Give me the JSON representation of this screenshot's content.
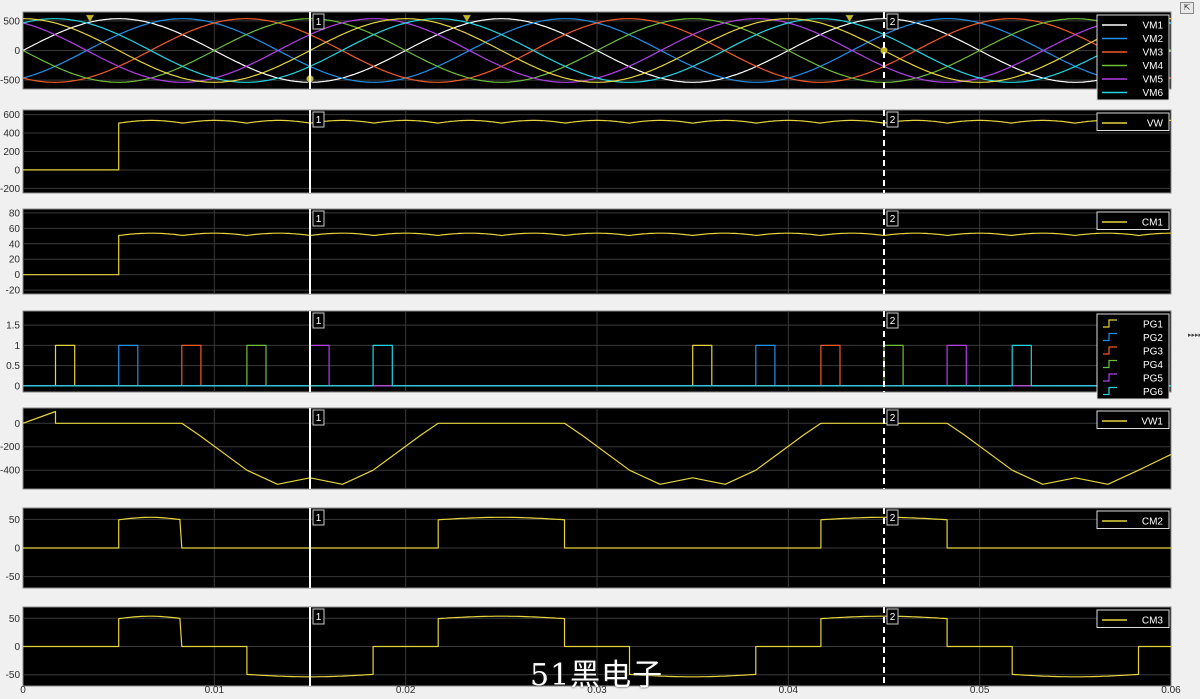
{
  "toolbar": {
    "undock_icon": "undock-icon",
    "side_arrows": "▸▸▸▸▸▸"
  },
  "watermark": "51黑电子",
  "colors": {
    "background": "#000000",
    "grid": "#3a3a3a",
    "axis_text": "#2b2b2b",
    "cursor": "#ffffff",
    "series": [
      "#ffffff",
      "#1f8fe8",
      "#f05a28",
      "#6fbf3a",
      "#b040e8",
      "#22d4e0",
      "#e6d43c"
    ],
    "marker": "#c8b820"
  },
  "cursors": [
    {
      "label": "1",
      "x": 0.015,
      "style": "solid"
    },
    {
      "label": "2",
      "x": 0.045,
      "style": "dashed"
    }
  ],
  "chart_data": [
    {
      "type": "line",
      "id": "vm",
      "x_ticks": [
        0,
        0.01,
        0.02,
        0.03,
        0.04,
        0.05,
        0.06
      ],
      "ylim": [
        -650,
        650
      ],
      "yticks": [
        500,
        0,
        -500
      ],
      "series": [
        {
          "name": "VM1",
          "color": "#ffffff",
          "amplitude": 537,
          "phase_deg": 0
        },
        {
          "name": "VM2",
          "color": "#1f8fe8",
          "amplitude": 537,
          "phase_deg": -60
        },
        {
          "name": "VM3",
          "color": "#f05a28",
          "amplitude": 537,
          "phase_deg": -120
        },
        {
          "name": "VM4",
          "color": "#6fbf3a",
          "amplitude": 537,
          "phase_deg": 180
        },
        {
          "name": "VM5",
          "color": "#b040e8",
          "amplitude": 537,
          "phase_deg": 120
        },
        {
          "name": "VM6",
          "color": "#22d4e0",
          "amplitude": 537,
          "phase_deg": 60
        }
      ],
      "frequency_hz": 50,
      "yellow_trace": {
        "phase_deg": 90,
        "amplitude": 537
      },
      "peak_markers_x": [
        0.0035,
        0.0232,
        0.0432
      ],
      "cursor_points": [
        {
          "x": 0.015,
          "y": -480
        },
        {
          "x": 0.045,
          "y": 0
        }
      ]
    },
    {
      "type": "line",
      "id": "vw",
      "ylim": [
        -250,
        650
      ],
      "yticks": [
        600,
        400,
        200,
        0,
        -200
      ],
      "series": [
        {
          "name": "VW",
          "color": "#e6d43c",
          "step_on": 0.005,
          "max": 537,
          "min": 465,
          "ripple_period": 0.00333
        }
      ]
    },
    {
      "type": "line",
      "id": "cm1",
      "ylim": [
        -25,
        85
      ],
      "yticks": [
        80,
        60,
        40,
        20,
        0,
        -20
      ],
      "series": [
        {
          "name": "CM1",
          "color": "#e6d43c",
          "step_on": 0.005,
          "max": 53.7,
          "min": 46.5,
          "ripple_period": 0.00333
        }
      ]
    },
    {
      "type": "line",
      "id": "pg",
      "ylim": [
        -0.15,
        1.85
      ],
      "yticks": [
        1.5,
        1,
        0.5,
        0
      ],
      "pulse_width": 0.001,
      "series": [
        {
          "name": "PG1",
          "color": "#e6d43c",
          "starts": [
            0.0017,
            0.035
          ]
        },
        {
          "name": "PG2",
          "color": "#1f8fe8",
          "starts": [
            0.005,
            0.0383
          ]
        },
        {
          "name": "PG3",
          "color": "#f05a28",
          "starts": [
            0.0083,
            0.0417
          ]
        },
        {
          "name": "PG4",
          "color": "#6fbf3a",
          "starts": [
            0.0117,
            0.045
          ]
        },
        {
          "name": "PG5",
          "color": "#b040e8",
          "starts": [
            0.015,
            0.0483
          ]
        },
        {
          "name": "PG6",
          "color": "#22d4e0",
          "starts": [
            0.0183,
            0.0517
          ]
        }
      ]
    },
    {
      "type": "line",
      "id": "vw1",
      "ylim": [
        -560,
        130
      ],
      "yticks": [
        0,
        -200,
        -400
      ],
      "series": [
        {
          "name": "VW1",
          "color": "#e6d43c",
          "points": [
            [
              0,
              0
            ],
            [
              0.0017,
              100
            ],
            [
              0.0017,
              0
            ],
            [
              0.0083,
              0
            ],
            [
              0.0092,
              -100
            ],
            [
              0.0117,
              -400
            ],
            [
              0.0133,
              -520
            ],
            [
              0.015,
              -465
            ],
            [
              0.0167,
              -520
            ],
            [
              0.0183,
              -400
            ],
            [
              0.0208,
              -100
            ],
            [
              0.0217,
              0
            ],
            [
              0.0283,
              0
            ],
            [
              0.0292,
              -100
            ],
            [
              0.0317,
              -400
            ],
            [
              0.0333,
              -520
            ],
            [
              0.035,
              -465
            ],
            [
              0.0367,
              -520
            ],
            [
              0.0383,
              -400
            ],
            [
              0.0408,
              -100
            ],
            [
              0.0417,
              0
            ],
            [
              0.0483,
              0
            ],
            [
              0.0492,
              -100
            ],
            [
              0.0517,
              -400
            ],
            [
              0.0533,
              -520
            ],
            [
              0.055,
              -465
            ],
            [
              0.0567,
              -520
            ],
            [
              0.0583,
              -400
            ],
            [
              0.06,
              -265
            ]
          ]
        }
      ]
    },
    {
      "type": "line",
      "id": "cm2",
      "ylim": [
        -70,
        70
      ],
      "yticks": [
        50,
        0,
        -50
      ],
      "series": [
        {
          "name": "CM2",
          "color": "#e6d43c",
          "segments": [
            [
              0.005,
              0.0083
            ],
            [
              0.0217,
              0.0283
            ],
            [
              0.0417,
              0.0483
            ]
          ],
          "level": 53.7
        }
      ]
    },
    {
      "type": "line",
      "id": "cm3",
      "ylim": [
        -70,
        70
      ],
      "yticks": [
        50,
        0,
        -50
      ],
      "series": [
        {
          "name": "CM3",
          "color": "#e6d43c",
          "pos_segments": [
            [
              0.005,
              0.0083
            ],
            [
              0.0217,
              0.0283
            ],
            [
              0.0417,
              0.0483
            ]
          ],
          "neg_segments": [
            [
              0.0117,
              0.0183
            ],
            [
              0.0317,
              0.0383
            ],
            [
              0.0517,
              0.0583
            ]
          ],
          "level": 53.7
        }
      ]
    }
  ]
}
